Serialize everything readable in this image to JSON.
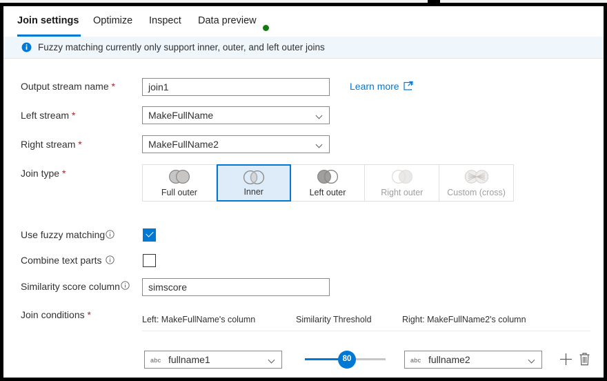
{
  "window": {
    "accent_color": "#0078d4",
    "banner_bg": "#eff6fc",
    "selected_bg": "#deecf9",
    "required_color": "#a4262c",
    "status_dot_color": "#107c10"
  },
  "tabs": [
    {
      "label": "Join settings",
      "active": true
    },
    {
      "label": "Optimize",
      "active": false
    },
    {
      "label": "Inspect",
      "active": false
    },
    {
      "label": "Data preview",
      "active": false,
      "status_dot": true
    }
  ],
  "banner": {
    "icon": "info-icon",
    "message": "Fuzzy matching currently only support inner, outer, and left outer joins"
  },
  "form": {
    "output_stream": {
      "label": "Output stream name",
      "required": "*",
      "value": "join1",
      "placeholder": "Output stream name"
    },
    "left_stream": {
      "label": "Left stream",
      "required": "*",
      "value": "MakeFullName"
    },
    "right_stream": {
      "label": "Right stream",
      "required": "*",
      "value": "MakeFullName2"
    },
    "join_type": {
      "label": "Join type",
      "required": "*",
      "options": [
        {
          "label": "Full outer",
          "icon": "full-outer-join-icon",
          "selected": false,
          "disabled": false
        },
        {
          "label": "Inner",
          "icon": "inner-join-icon",
          "selected": true,
          "disabled": false
        },
        {
          "label": "Left outer",
          "icon": "left-outer-join-icon",
          "selected": false,
          "disabled": false
        },
        {
          "label": "Right outer",
          "icon": "right-outer-join-icon",
          "selected": false,
          "disabled": true
        },
        {
          "label": "Custom (cross)",
          "icon": "custom-cross-join-icon",
          "selected": false,
          "disabled": true
        }
      ]
    },
    "use_fuzzy_matching": {
      "label": "Use fuzzy matching",
      "checked": true,
      "info_icon": "info-circle-icon"
    },
    "combine_text_parts": {
      "label": "Combine text parts",
      "checked": false,
      "info_icon": "info-circle-icon"
    },
    "similarity_score_column": {
      "label": "Similarity score column",
      "value": "simscore",
      "info_icon": "info-circle-icon"
    },
    "join_conditions": {
      "label": "Join conditions",
      "required": "*",
      "columns": [
        "Left: MakeFullName's column",
        "Similarity Threshold",
        "Right: MakeFullName2's column"
      ],
      "rows": [
        {
          "left_type": "abc",
          "left_column": "fullname1",
          "threshold": "80",
          "threshold_percent": 44,
          "right_type": "abc",
          "right_column": "fullname2"
        }
      ],
      "add_label": "add-row",
      "delete_label": "delete-row"
    }
  },
  "links": {
    "learn_more": "Learn more",
    "learn_more_icon": "external-link-icon"
  }
}
